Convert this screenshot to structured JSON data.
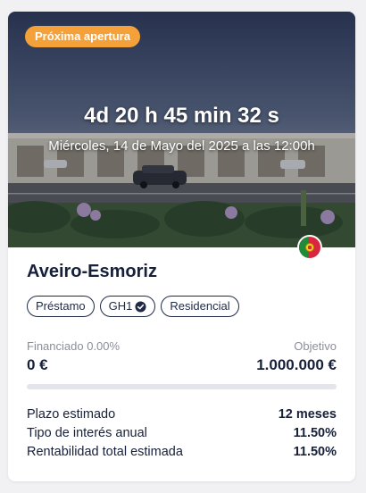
{
  "card": {
    "badge": "Próxima apertura",
    "countdown": "4d 20 h 45 min 32 s",
    "opening_date": "Miércoles, 14 de Mayo del 2025 a las 12:00h",
    "country_flag": "portugal-flag",
    "title": "Aveiro-Esmoriz",
    "tags": [
      {
        "label": "Préstamo"
      },
      {
        "label": "GH1",
        "icon": "verified-check-icon"
      },
      {
        "label": "Residencial"
      }
    ],
    "financing": {
      "financed_label": "Financiado 0.00%",
      "target_label": "Objetivo",
      "financed_amount": "0 €",
      "target_amount": "1.000.000 €",
      "progress_percent": 0
    },
    "details": [
      {
        "label": "Plazo estimado",
        "value": "12 meses"
      },
      {
        "label": "Tipo de interés anual",
        "value": "11.50%"
      },
      {
        "label": "Rentabilidad total estimada",
        "value": "11.50%"
      }
    ]
  },
  "colors": {
    "accent": "#f4a13a",
    "text_dark": "#17203a",
    "text_muted": "#8a8f9c",
    "track": "#e3e5ea"
  }
}
